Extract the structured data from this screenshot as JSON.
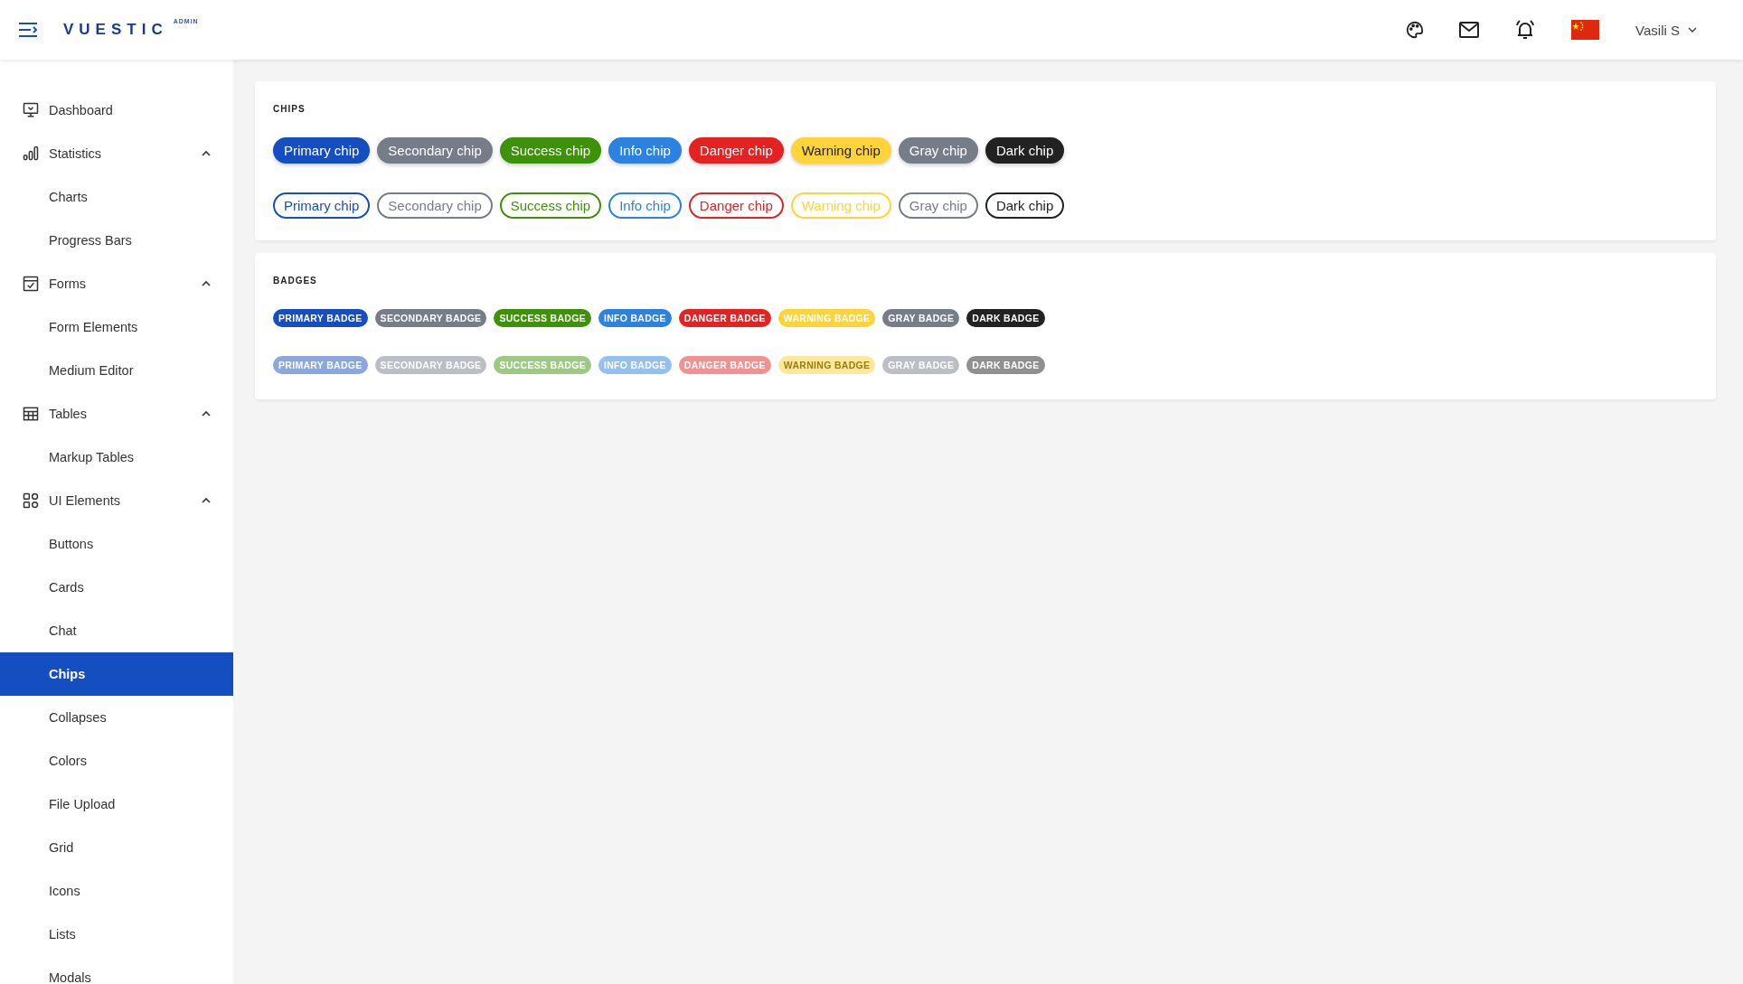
{
  "header": {
    "logo": "VUESTIC",
    "logo_badge": "ADMIN",
    "user": "Vasili S"
  },
  "sidebar": {
    "items": [
      {
        "label": "Dashboard",
        "kind": "monitor",
        "selected": false
      },
      {
        "label": "Statistics",
        "kind": "bars",
        "expanded": true,
        "children": [
          {
            "label": "Charts",
            "selected": false
          },
          {
            "label": "Progress Bars",
            "selected": false
          }
        ]
      },
      {
        "label": "Forms",
        "kind": "form",
        "expanded": true,
        "children": [
          {
            "label": "Form Elements",
            "selected": false
          },
          {
            "label": "Medium Editor",
            "selected": false
          }
        ]
      },
      {
        "label": "Tables",
        "kind": "table",
        "expanded": true,
        "children": [
          {
            "label": "Markup Tables",
            "selected": false
          }
        ]
      },
      {
        "label": "UI Elements",
        "kind": "widgets",
        "expanded": true,
        "children": [
          {
            "label": "Buttons",
            "selected": false
          },
          {
            "label": "Cards",
            "selected": false
          },
          {
            "label": "Chat",
            "selected": false
          },
          {
            "label": "Chips",
            "selected": true
          },
          {
            "label": "Collapses",
            "selected": false
          },
          {
            "label": "Colors",
            "selected": false
          },
          {
            "label": "File Upload",
            "selected": false
          },
          {
            "label": "Grid",
            "selected": false
          },
          {
            "label": "Icons",
            "selected": false
          },
          {
            "label": "Lists",
            "selected": false
          },
          {
            "label": "Modals",
            "selected": false
          }
        ]
      }
    ]
  },
  "chips_card": {
    "title": "CHIPS",
    "rows": [
      {
        "kind": "filled",
        "chips": [
          {
            "label": "Primary chip",
            "color": "#154ec1"
          },
          {
            "label": "Secondary chip",
            "color": "#767c88"
          },
          {
            "label": "Success chip",
            "color": "#3d9209"
          },
          {
            "label": "Info chip",
            "color": "#2c82e0"
          },
          {
            "label": "Danger chip",
            "color": "#e42222"
          },
          {
            "label": "Warning chip",
            "color": "#ffd43a"
          },
          {
            "label": "Gray chip",
            "color": "#767c88"
          },
          {
            "label": "Dark chip",
            "color": "#222222"
          }
        ]
      },
      {
        "kind": "outline",
        "chips": [
          {
            "label": "Primary chip",
            "color": "#154ec1"
          },
          {
            "label": "Secondary chip",
            "color": "#767c88"
          },
          {
            "label": "Success chip",
            "color": "#3d9209"
          },
          {
            "label": "Info chip",
            "color": "#2c82e0"
          },
          {
            "label": "Danger chip",
            "color": "#e42222"
          },
          {
            "label": "Warning chip",
            "color": "#ffd43a"
          },
          {
            "label": "Gray chip",
            "color": "#767c88"
          },
          {
            "label": "Dark chip",
            "color": "#222222"
          }
        ]
      }
    ]
  },
  "badges_card": {
    "title": "BADGES",
    "rows": [
      {
        "badges": [
          {
            "label": "PRIMARY BADGE",
            "color": "#154ec1"
          },
          {
            "label": "SECONDARY BADGE",
            "color": "#767c88"
          },
          {
            "label": "SUCCESS BADGE",
            "color": "#3d9209"
          },
          {
            "label": "INFO BADGE",
            "color": "#2c82e0"
          },
          {
            "label": "DANGER BADGE",
            "color": "#e42222"
          },
          {
            "label": "WARNING BADGE",
            "color": "#ffd43a"
          },
          {
            "label": "GRAY BADGE",
            "color": "#767c88"
          },
          {
            "label": "DARK BADGE",
            "color": "#222222"
          }
        ]
      },
      {
        "badges": [
          {
            "label": "PRIMARY BADGE",
            "color": "#8aa7e0"
          },
          {
            "label": "SECONDARY BADGE",
            "color": "#bbbec4"
          },
          {
            "label": "SUCCESS BADGE",
            "color": "#9ec984"
          },
          {
            "label": "INFO BADGE",
            "color": "#95c1f0"
          },
          {
            "label": "DANGER BADGE",
            "color": "#f29191"
          },
          {
            "label": "WARNING BADGE",
            "color": "#ffe79c"
          },
          {
            "label": "GRAY BADGE",
            "color": "#bbbec4"
          },
          {
            "label": "DARK BADGE",
            "color": "#909090"
          }
        ]
      }
    ]
  }
}
